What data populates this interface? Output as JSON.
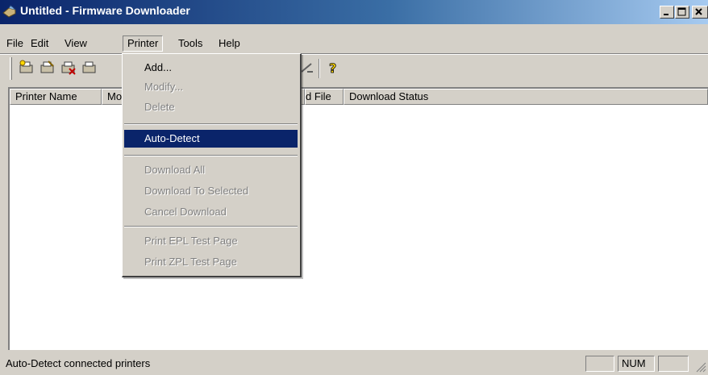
{
  "window": {
    "title": "Untitled - Firmware Downloader",
    "icon": "app-icon"
  },
  "menubar": {
    "items": [
      {
        "label": "File"
      },
      {
        "label": "Edit"
      },
      {
        "label": "View"
      },
      {
        "label": "Printer",
        "open": true
      },
      {
        "label": "Tools"
      },
      {
        "label": "Help"
      }
    ]
  },
  "toolbar": {
    "buttons": [
      {
        "icon": "add-printer-icon"
      },
      {
        "icon": "modify-printer-icon"
      },
      {
        "icon": "delete-printer-icon"
      },
      {
        "icon": "auto-detect-icon"
      },
      {
        "icon": "download-icon"
      },
      {
        "icon": "help-icon"
      }
    ]
  },
  "listview": {
    "columns": [
      {
        "label": "Printer Name"
      },
      {
        "label": "Mo"
      },
      {
        "label": "d File"
      },
      {
        "label": "Download Status"
      }
    ]
  },
  "printer_menu": {
    "items": [
      {
        "label": "Add...",
        "enabled": true
      },
      {
        "label": "Modify...",
        "enabled": false
      },
      {
        "label": "Delete",
        "enabled": false
      },
      {
        "label": "Auto-Detect",
        "enabled": true,
        "highlighted": true
      },
      {
        "label": "Download All",
        "enabled": false
      },
      {
        "label": "Download To Selected",
        "enabled": false
      },
      {
        "label": "Cancel Download",
        "enabled": false
      },
      {
        "label": "Print EPL Test Page",
        "enabled": false
      },
      {
        "label": "Print ZPL Test Page",
        "enabled": false
      }
    ]
  },
  "statusbar": {
    "message": "Auto-Detect connected printers",
    "num_indicator": "NUM"
  },
  "colors": {
    "title_active": "#0a246a",
    "face": "#d4d0c8",
    "highlight": "#0a246a",
    "disabled_text": "#808080"
  }
}
